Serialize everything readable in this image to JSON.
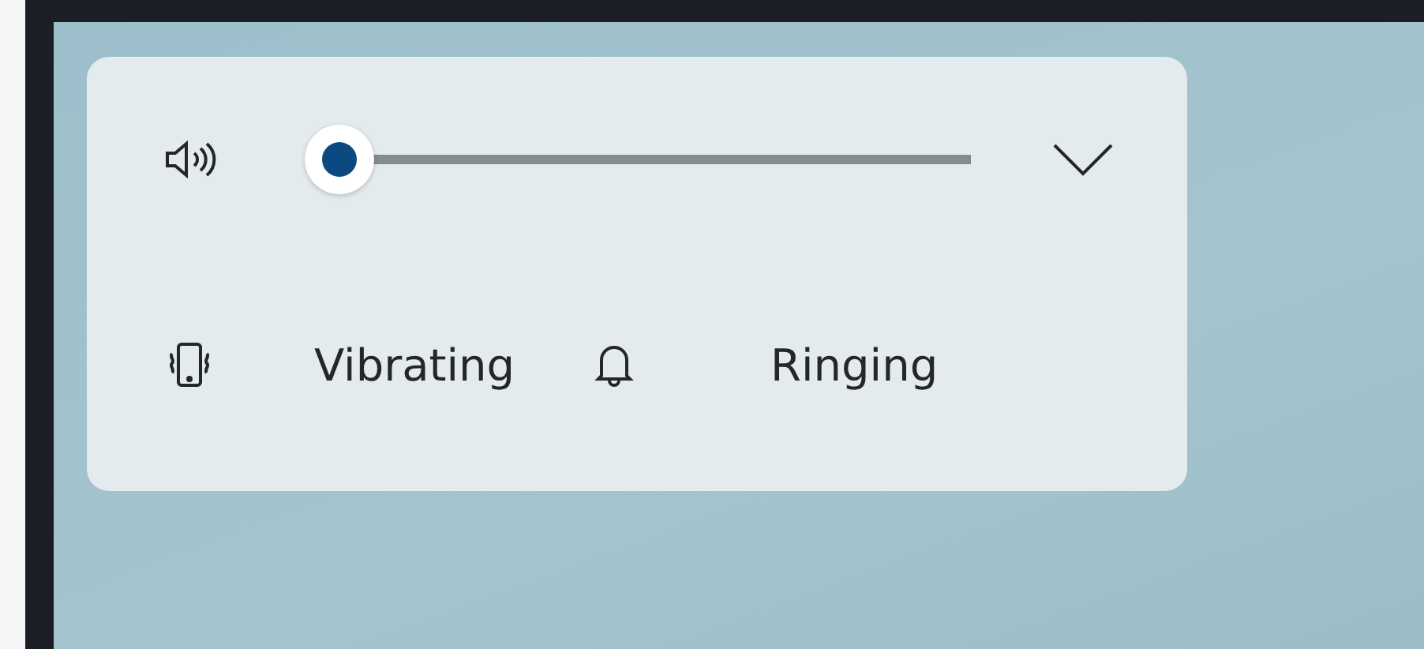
{
  "modes": [
    {
      "kind": "vibrate",
      "label": "Vibrating"
    },
    {
      "kind": "ring",
      "label": "Ringing"
    }
  ]
}
